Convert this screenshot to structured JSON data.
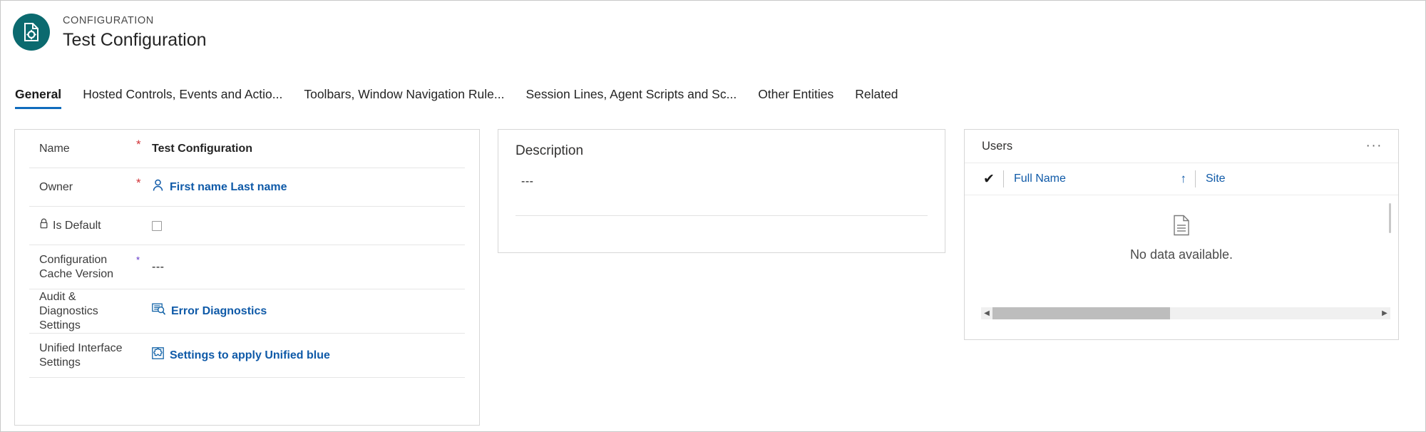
{
  "header": {
    "eyebrow": "CONFIGURATION",
    "title": "Test Configuration",
    "icon": "document-gear-icon",
    "icon_bg": "#0b6a6f"
  },
  "tabs": [
    {
      "label": "General",
      "active": true
    },
    {
      "label": "Hosted Controls, Events and Actio...",
      "active": false
    },
    {
      "label": "Toolbars, Window Navigation Rule...",
      "active": false
    },
    {
      "label": "Session Lines, Agent Scripts and Sc...",
      "active": false
    },
    {
      "label": "Other Entities",
      "active": false
    },
    {
      "label": "Related",
      "active": false
    }
  ],
  "tab_accent": "#0f6cbd",
  "form": {
    "rows": [
      {
        "label": "Name",
        "required": "*",
        "required_color": "#d13438",
        "value": "Test Configuration",
        "type": "text-bold"
      },
      {
        "label": "Owner",
        "required": "*",
        "required_color": "#d13438",
        "value": "First name Last name",
        "type": "link",
        "icon": "person-icon"
      },
      {
        "label": "Is Default",
        "required": "",
        "required_color": "",
        "value": "",
        "type": "checkbox",
        "icon": "lock-icon",
        "checked": false
      },
      {
        "label": "Configuration Cache Version",
        "required": "*",
        "required_color": "#5b2ec7",
        "value": "---",
        "type": "dashes"
      },
      {
        "label": "Audit & Diagnostics Settings",
        "required": "",
        "required_color": "",
        "value": "Error Diagnostics",
        "type": "link",
        "icon": "error-diagnostics-icon"
      },
      {
        "label": "Unified Interface Settings",
        "required": "",
        "required_color": "",
        "value": "Settings to apply Unified blue",
        "type": "link",
        "icon": "puzzle-piece-icon"
      }
    ]
  },
  "description": {
    "title": "Description",
    "value": "---"
  },
  "users": {
    "title": "Users",
    "more_label": "···",
    "columns": [
      {
        "label": "Full Name",
        "sort": "ascending",
        "sort_glyph": "↑"
      },
      {
        "label": "Site",
        "sort": "",
        "sort_glyph": ""
      }
    ],
    "select_all_glyph": "✔",
    "empty_state": {
      "icon": "empty-document-icon",
      "message": "No data available."
    },
    "scrollbar": {
      "left_glyph": "◀",
      "right_glyph": "▶"
    }
  }
}
